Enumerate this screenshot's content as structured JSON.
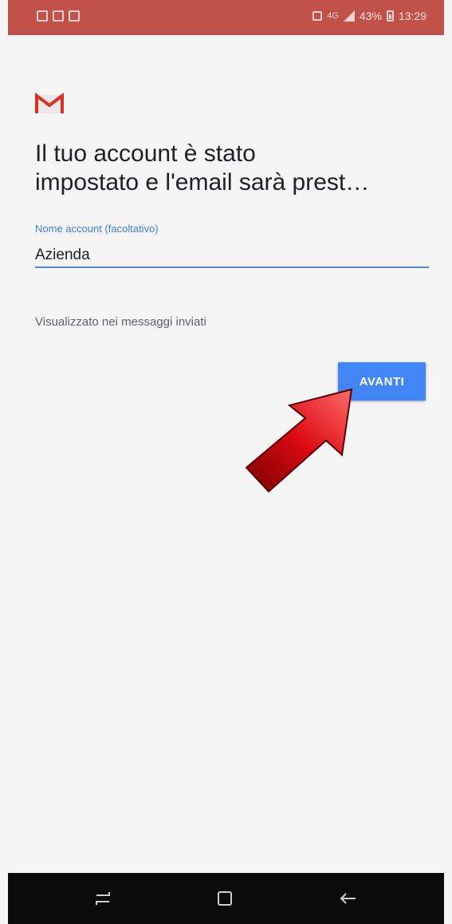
{
  "status_bar": {
    "battery_percent": "43%",
    "time": "13:29",
    "network": "4G",
    "icons_left": [
      "gallery-icon",
      "mail-icon",
      "image-icon"
    ],
    "icons_right": [
      "mute-icon",
      "signal-icon",
      "battery-icon"
    ]
  },
  "app": {
    "logo": "gmail-logo",
    "title_line1": "Il tuo account è stato",
    "title_line2": "impostato e l'email sarà prest…"
  },
  "form": {
    "account_name_label": "Nome account (facoltativo)",
    "account_name_value": "Azienda",
    "helper_text": "Visualizzato nei messaggi inviati",
    "next_button": "AVANTI"
  },
  "nav_bar": {
    "buttons": [
      "recents-icon",
      "home-icon",
      "back-icon"
    ]
  },
  "colors": {
    "status_bar": "#c1524a",
    "accent_blue": "#4285f4",
    "arrow_red": "#c4060b"
  }
}
